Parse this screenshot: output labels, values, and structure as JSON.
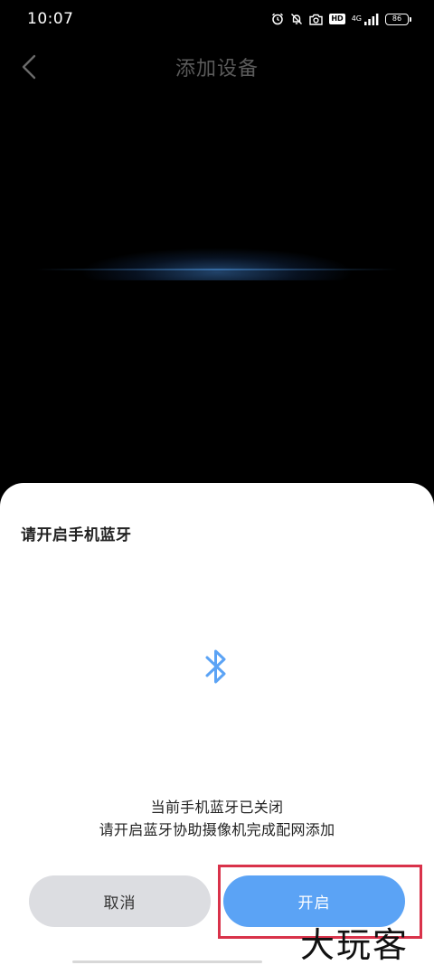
{
  "status_bar": {
    "time": "10:07",
    "network_type": "4G",
    "hd_label": "HD",
    "battery_level": "86",
    "icons": [
      "alarm-icon",
      "mute-bell-icon",
      "camera-icon",
      "hd-icon",
      "signal-icon",
      "battery-icon"
    ]
  },
  "nav": {
    "title": "添加设备",
    "back_icon": "chevron-left-icon"
  },
  "sheet": {
    "title": "请开启手机蓝牙",
    "icon": "bluetooth-icon",
    "message_line1": "当前手机蓝牙已关闭",
    "message_line2": "请开启蓝牙协助摄像机完成配网添加",
    "cancel_label": "取消",
    "open_label": "开启"
  },
  "watermark": "大玩客",
  "colors": {
    "accent": "#5ba3f5",
    "cancel_bg": "#dcdde1",
    "highlight": "#d9324a",
    "background": "#000000"
  }
}
